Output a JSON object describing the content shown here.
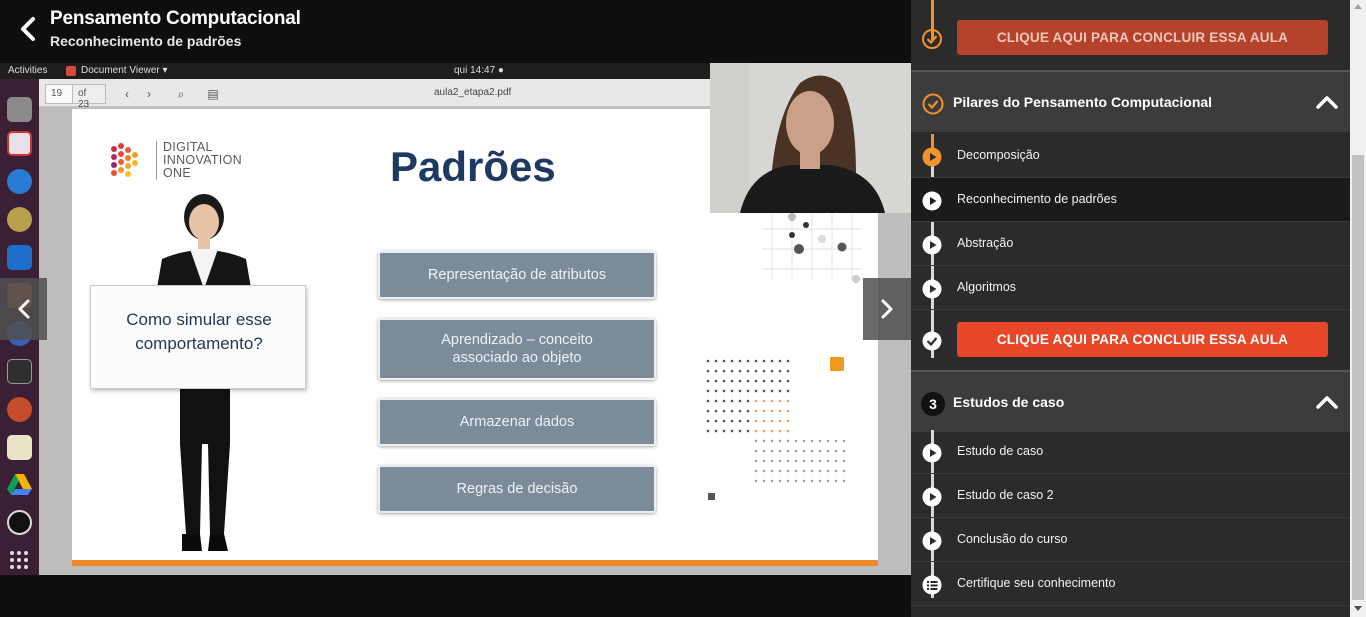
{
  "header": {
    "course_title": "Pensamento Computacional",
    "lesson_title": "Reconhecimento de padrões"
  },
  "video": {
    "gnome_bar": {
      "activities": "Activities",
      "app_name": "Document Viewer ▾",
      "clock": "qui 14:47 ●"
    },
    "doc_toolbar": {
      "page_current": "19",
      "page_total": "of 23",
      "file_name": "aula2_etapa2.pdf"
    },
    "slide": {
      "logo_text": "DIGITAL INNOVATION ONE",
      "title": "Padrões",
      "sign_text": "Como simular esse comportamento?",
      "pills": [
        "Representação de atributos",
        "Aprendizado – conceito associado ao objeto",
        "Armazenar dados",
        "Regras de decisão"
      ]
    }
  },
  "sidebar": {
    "top_conclude_label": "CLIQUE AQUI PARA CONCLUIR ESSA AULA",
    "section2": {
      "title": "Pilares do Pensamento Computacional",
      "items": [
        "Decomposição",
        "Reconhecimento de padrões",
        "Abstração",
        "Algoritmos"
      ],
      "conclude_label": "CLIQUE AQUI PARA CONCLUIR ESSA AULA"
    },
    "section3": {
      "number": "3",
      "title": "Estudos de caso",
      "items": [
        "Estudo de caso",
        "Estudo de caso 2",
        "Conclusão do curso",
        "Certifique seu conhecimento"
      ]
    }
  },
  "colors": {
    "accent_orange": "#f0942b",
    "conclude_red": "#e8472a",
    "conclude_red_dim": "#b5432c"
  }
}
